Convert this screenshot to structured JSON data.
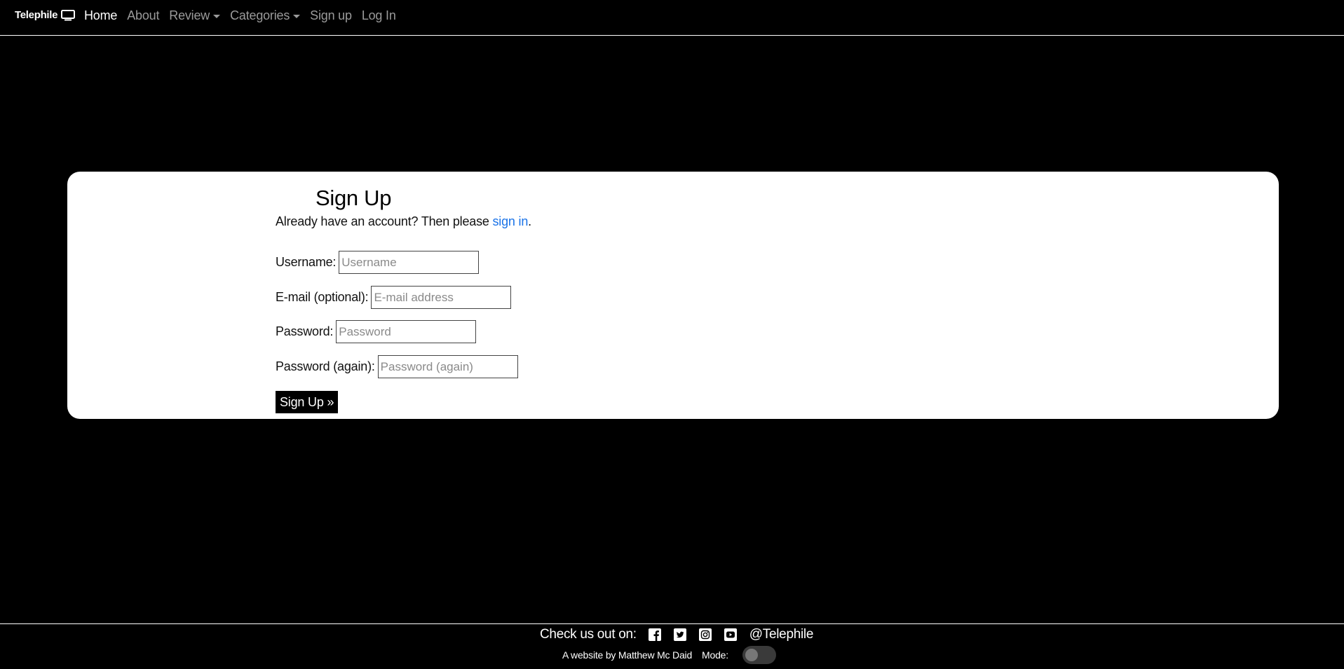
{
  "navbar": {
    "brand": "Telephile",
    "brand_icon": "tv-icon",
    "items": [
      {
        "label": "Home",
        "active": true
      },
      {
        "label": "About"
      },
      {
        "label": "Review",
        "dropdown": true
      },
      {
        "label": "Categories",
        "dropdown": true
      },
      {
        "label": "Sign up"
      },
      {
        "label": "Log In"
      }
    ]
  },
  "signup": {
    "title": "Sign Up",
    "intro_prefix": "Already have an account? Then please ",
    "intro_link": "sign in",
    "intro_suffix": ".",
    "fields": [
      {
        "label": "Username:",
        "placeholder": "Username",
        "value": ""
      },
      {
        "label": "E-mail (optional):",
        "placeholder": "E-mail address",
        "value": ""
      },
      {
        "label": "Password:",
        "placeholder": "Password",
        "value": ""
      },
      {
        "label": "Password (again):",
        "placeholder": "Password (again)",
        "value": ""
      }
    ],
    "submit_label": "Sign Up »"
  },
  "footer": {
    "check_us": "Check us out on:",
    "social_icons": [
      "facebook-icon",
      "twitter-icon",
      "instagram-icon",
      "youtube-icon"
    ],
    "handle": "@Telephile",
    "credit": "A website by Matthew Mc Daid",
    "mode_label": "Mode:",
    "mode_dark": false
  },
  "colors": {
    "background": "#000000",
    "card": "#ffffff",
    "link": "#1a73e8",
    "nav_inactive": "#9a9a9a"
  }
}
